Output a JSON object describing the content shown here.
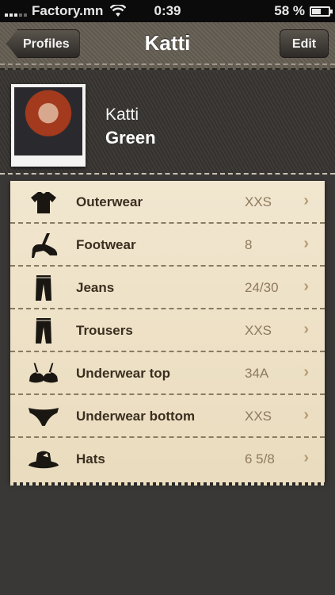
{
  "status_bar": {
    "carrier": "Factory.mn",
    "time": "0:39",
    "battery_percent": "58 %",
    "battery_level": 0.58
  },
  "nav": {
    "back_label": "Profiles",
    "title": "Katti",
    "edit_label": "Edit"
  },
  "profile": {
    "first_name": "Katti",
    "last_name": "Green"
  },
  "items": [
    {
      "icon": "tshirt-icon",
      "label": "Outerwear",
      "value": "XXS"
    },
    {
      "icon": "high-heel-shoe-icon",
      "label": "Footwear",
      "value": "8"
    },
    {
      "icon": "jeans-icon",
      "label": "Jeans",
      "value": "24/30"
    },
    {
      "icon": "trousers-icon",
      "label": "Trousers",
      "value": "XXS"
    },
    {
      "icon": "bra-icon",
      "label": "Underwear top",
      "value": "34A"
    },
    {
      "icon": "briefs-icon",
      "label": "Underwear bottom",
      "value": "XXS"
    },
    {
      "icon": "hat-icon",
      "label": "Hats",
      "value": "6 5/8"
    }
  ],
  "colors": {
    "nav_background": "#635c52",
    "list_background": "#f1e6cf",
    "label_text": "#3a2e20",
    "value_text": "#8e7a5e"
  }
}
